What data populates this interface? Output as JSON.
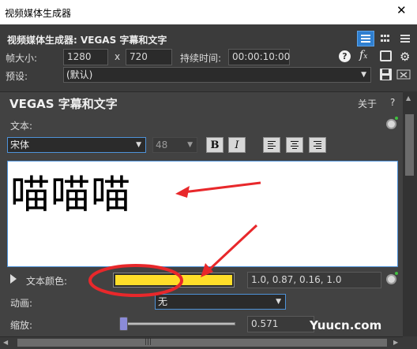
{
  "window": {
    "title": "视频媒体生成器",
    "close_glyph": "✕"
  },
  "header": {
    "heading": "视频媒体生成器: VEGAS 字幕和文字",
    "frame_size_label": "帧大小:",
    "width": "1280",
    "x_sep": "x",
    "height": "720",
    "duration_label": "持续时间:",
    "duration": "00:00:10:00",
    "preset_label": "预设:",
    "preset_value": "(默认)"
  },
  "plugin": {
    "title": "VEGAS 字幕和文字",
    "about": "关于",
    "help": "?",
    "text_label": "文本:",
    "font": "宋体",
    "font_size": "48",
    "bold_glyph": "B",
    "italic_glyph": "I",
    "text_content": "喵喵喵",
    "text_color_label": "文本颜色:",
    "text_color_value": "1.0, 0.87, 0.16, 1.0",
    "text_color_hex": "#FFDE29",
    "animation_label": "动画:",
    "animation_value": "无",
    "scale_label": "缩放:",
    "scale_value": "0.571"
  },
  "watermark": "Yuucn.com",
  "annotation_colors": {
    "arrows": "#E8282B"
  },
  "icons": [
    "question-icon",
    "fx-icon",
    "film-icon",
    "gear-icon",
    "save-icon",
    "list-view-icon",
    "grid-view-icon"
  ]
}
